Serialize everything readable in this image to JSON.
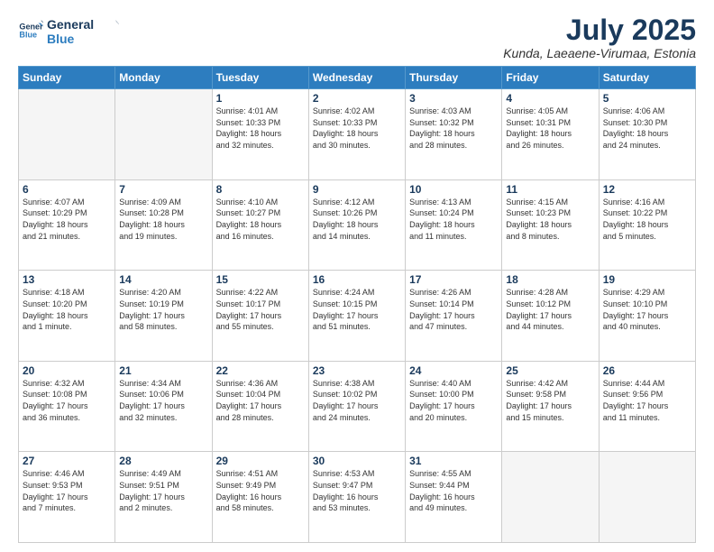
{
  "logo": {
    "line1": "General",
    "line2": "Blue"
  },
  "title": "July 2025",
  "subtitle": "Kunda, Laeaene-Virumaa, Estonia",
  "headers": [
    "Sunday",
    "Monday",
    "Tuesday",
    "Wednesday",
    "Thursday",
    "Friday",
    "Saturday"
  ],
  "weeks": [
    [
      {
        "day": "",
        "info": ""
      },
      {
        "day": "",
        "info": ""
      },
      {
        "day": "1",
        "info": "Sunrise: 4:01 AM\nSunset: 10:33 PM\nDaylight: 18 hours\nand 32 minutes."
      },
      {
        "day": "2",
        "info": "Sunrise: 4:02 AM\nSunset: 10:33 PM\nDaylight: 18 hours\nand 30 minutes."
      },
      {
        "day": "3",
        "info": "Sunrise: 4:03 AM\nSunset: 10:32 PM\nDaylight: 18 hours\nand 28 minutes."
      },
      {
        "day": "4",
        "info": "Sunrise: 4:05 AM\nSunset: 10:31 PM\nDaylight: 18 hours\nand 26 minutes."
      },
      {
        "day": "5",
        "info": "Sunrise: 4:06 AM\nSunset: 10:30 PM\nDaylight: 18 hours\nand 24 minutes."
      }
    ],
    [
      {
        "day": "6",
        "info": "Sunrise: 4:07 AM\nSunset: 10:29 PM\nDaylight: 18 hours\nand 21 minutes."
      },
      {
        "day": "7",
        "info": "Sunrise: 4:09 AM\nSunset: 10:28 PM\nDaylight: 18 hours\nand 19 minutes."
      },
      {
        "day": "8",
        "info": "Sunrise: 4:10 AM\nSunset: 10:27 PM\nDaylight: 18 hours\nand 16 minutes."
      },
      {
        "day": "9",
        "info": "Sunrise: 4:12 AM\nSunset: 10:26 PM\nDaylight: 18 hours\nand 14 minutes."
      },
      {
        "day": "10",
        "info": "Sunrise: 4:13 AM\nSunset: 10:24 PM\nDaylight: 18 hours\nand 11 minutes."
      },
      {
        "day": "11",
        "info": "Sunrise: 4:15 AM\nSunset: 10:23 PM\nDaylight: 18 hours\nand 8 minutes."
      },
      {
        "day": "12",
        "info": "Sunrise: 4:16 AM\nSunset: 10:22 PM\nDaylight: 18 hours\nand 5 minutes."
      }
    ],
    [
      {
        "day": "13",
        "info": "Sunrise: 4:18 AM\nSunset: 10:20 PM\nDaylight: 18 hours\nand 1 minute."
      },
      {
        "day": "14",
        "info": "Sunrise: 4:20 AM\nSunset: 10:19 PM\nDaylight: 17 hours\nand 58 minutes."
      },
      {
        "day": "15",
        "info": "Sunrise: 4:22 AM\nSunset: 10:17 PM\nDaylight: 17 hours\nand 55 minutes."
      },
      {
        "day": "16",
        "info": "Sunrise: 4:24 AM\nSunset: 10:15 PM\nDaylight: 17 hours\nand 51 minutes."
      },
      {
        "day": "17",
        "info": "Sunrise: 4:26 AM\nSunset: 10:14 PM\nDaylight: 17 hours\nand 47 minutes."
      },
      {
        "day": "18",
        "info": "Sunrise: 4:28 AM\nSunset: 10:12 PM\nDaylight: 17 hours\nand 44 minutes."
      },
      {
        "day": "19",
        "info": "Sunrise: 4:29 AM\nSunset: 10:10 PM\nDaylight: 17 hours\nand 40 minutes."
      }
    ],
    [
      {
        "day": "20",
        "info": "Sunrise: 4:32 AM\nSunset: 10:08 PM\nDaylight: 17 hours\nand 36 minutes."
      },
      {
        "day": "21",
        "info": "Sunrise: 4:34 AM\nSunset: 10:06 PM\nDaylight: 17 hours\nand 32 minutes."
      },
      {
        "day": "22",
        "info": "Sunrise: 4:36 AM\nSunset: 10:04 PM\nDaylight: 17 hours\nand 28 minutes."
      },
      {
        "day": "23",
        "info": "Sunrise: 4:38 AM\nSunset: 10:02 PM\nDaylight: 17 hours\nand 24 minutes."
      },
      {
        "day": "24",
        "info": "Sunrise: 4:40 AM\nSunset: 10:00 PM\nDaylight: 17 hours\nand 20 minutes."
      },
      {
        "day": "25",
        "info": "Sunrise: 4:42 AM\nSunset: 9:58 PM\nDaylight: 17 hours\nand 15 minutes."
      },
      {
        "day": "26",
        "info": "Sunrise: 4:44 AM\nSunset: 9:56 PM\nDaylight: 17 hours\nand 11 minutes."
      }
    ],
    [
      {
        "day": "27",
        "info": "Sunrise: 4:46 AM\nSunset: 9:53 PM\nDaylight: 17 hours\nand 7 minutes."
      },
      {
        "day": "28",
        "info": "Sunrise: 4:49 AM\nSunset: 9:51 PM\nDaylight: 17 hours\nand 2 minutes."
      },
      {
        "day": "29",
        "info": "Sunrise: 4:51 AM\nSunset: 9:49 PM\nDaylight: 16 hours\nand 58 minutes."
      },
      {
        "day": "30",
        "info": "Sunrise: 4:53 AM\nSunset: 9:47 PM\nDaylight: 16 hours\nand 53 minutes."
      },
      {
        "day": "31",
        "info": "Sunrise: 4:55 AM\nSunset: 9:44 PM\nDaylight: 16 hours\nand 49 minutes."
      },
      {
        "day": "",
        "info": ""
      },
      {
        "day": "",
        "info": ""
      }
    ]
  ]
}
